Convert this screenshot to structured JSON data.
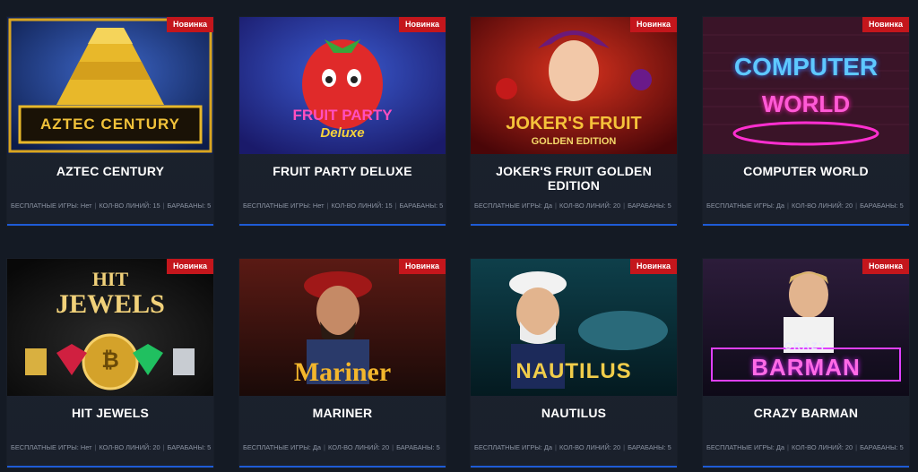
{
  "badge": "Новинка",
  "labels": {
    "free": "БЕСПЛАТНЫЕ ИГРЫ:",
    "lines": "КОЛ-ВО ЛИНИЙ:",
    "reels": "БАРАБАНЫ:"
  },
  "games": [
    {
      "title": "AZTEC CENTURY",
      "logo": "AZTEC CENTURY",
      "free": "Нет",
      "lines": "15",
      "reels": "5"
    },
    {
      "title": "FRUIT PARTY DELUXE",
      "logo": "FRUIT PARTY",
      "logo2": "Deluxe",
      "free": "Нет",
      "lines": "15",
      "reels": "5"
    },
    {
      "title": "JOKER'S FRUIT GOLDEN EDITION",
      "logo": "JOKER'S FRUIT",
      "logo2": "GOLDEN EDITION",
      "free": "Да",
      "lines": "20",
      "reels": "5"
    },
    {
      "title": "COMPUTER WORLD",
      "logo": "COMPUTER",
      "logo2": "WORLD",
      "free": "Да",
      "lines": "20",
      "reels": "5"
    },
    {
      "title": "HIT JEWELS",
      "logo": "HIT",
      "logo2": "JEWELS",
      "free": "Нет",
      "lines": "20",
      "reels": "5"
    },
    {
      "title": "MARINER",
      "logo": "Mariner",
      "free": "Да",
      "lines": "20",
      "reels": "5"
    },
    {
      "title": "NAUTILUS",
      "logo": "NAUTILUS",
      "free": "Да",
      "lines": "20",
      "reels": "5"
    },
    {
      "title": "CRAZY BARMAN",
      "logo": "CRAZY",
      "logo2": "BARMAN",
      "free": "Да",
      "lines": "20",
      "reels": "5"
    }
  ]
}
